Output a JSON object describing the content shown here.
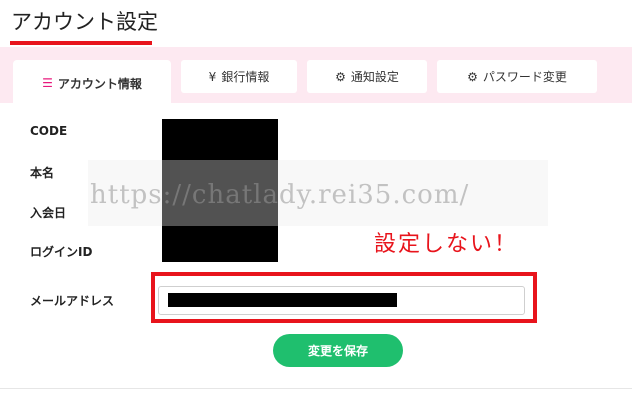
{
  "page": {
    "title": "アカウント設定"
  },
  "tabs": [
    {
      "label": "アカウント情報",
      "icon": "list-icon",
      "active": true
    },
    {
      "label": "銀行情報",
      "icon": "yen-icon",
      "active": false
    },
    {
      "label": "通知設定",
      "icon": "gear-icon",
      "active": false
    },
    {
      "label": "パスワード変更",
      "icon": "gear-icon",
      "active": false
    }
  ],
  "form": {
    "labels": {
      "code": "CODE",
      "name": "本名",
      "join_date": "入会日",
      "login_id": "ログインID",
      "email": "メールアドレス"
    },
    "save_label": "変更を保存"
  },
  "overlay": {
    "watermark": "https://chatlady.rei35.com/",
    "annotation": "設定しない！"
  },
  "colors": {
    "accent": "#e8141c",
    "tab_bar": "#fde9f1",
    "save_button": "#1fbf6e",
    "list_icon": "#e8197d"
  }
}
